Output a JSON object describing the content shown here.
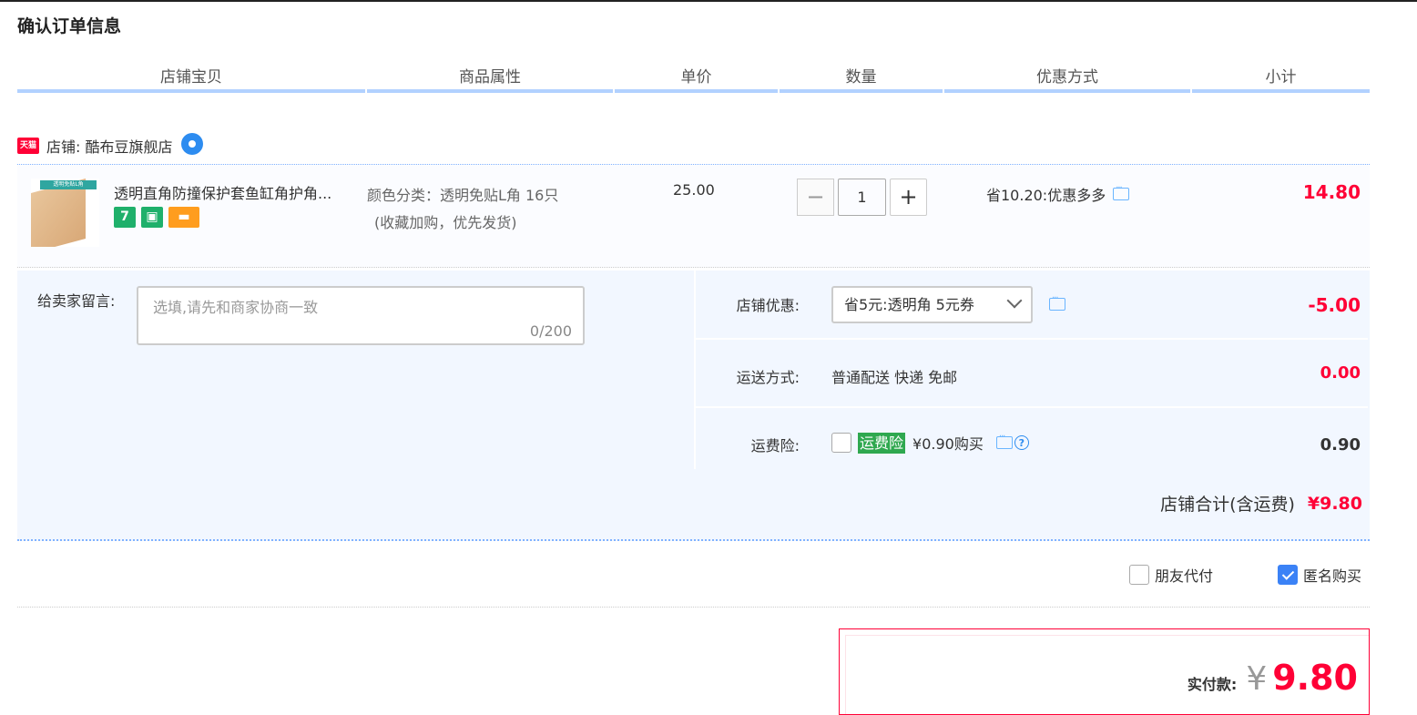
{
  "page_title": "确认订单信息",
  "columns": [
    "店铺宝贝",
    "商品属性",
    "单价",
    "数量",
    "优惠方式",
    "小计"
  ],
  "shop": {
    "platform_badge": "天猫",
    "label": "店铺: 酷布豆旗舰店"
  },
  "item": {
    "thumb_label": "透明免贴L角",
    "title": "透明直角防撞保护套鱼缸角护角...",
    "badges": [
      "7",
      "bag-icon",
      "card-icon"
    ],
    "attr_line1": "颜色分类：透明免贴L角 16只",
    "attr_line2": "(收藏加购，优先发货)",
    "unit_price": "25.00",
    "quantity": "1",
    "minus": "−",
    "plus": "+",
    "promo": "省10.20:优惠多多",
    "subtotal": "14.80"
  },
  "message": {
    "label": "给卖家留言:",
    "placeholder": "选填,请先和商家协商一致",
    "count": "0/200"
  },
  "shop_coupon": {
    "label": "店铺优惠:",
    "selected": "省5元:透明角 5元券",
    "value": "-5.00"
  },
  "shipping": {
    "label": "运送方式:",
    "text": "普通配送 快递 免邮",
    "value": "0.00"
  },
  "insurance": {
    "label": "运费险:",
    "tag": "运费险",
    "price_text": "¥0.90购买",
    "help": "?",
    "value": "0.90"
  },
  "shop_total": {
    "label": "店铺合计(含运费)",
    "value": "¥9.80"
  },
  "options": {
    "friend_pay": "朋友代付",
    "anonymous": "匿名购买",
    "anonymous_checked": true
  },
  "payment": {
    "label": "实付款:",
    "currency": "¥",
    "amount": "9.80"
  },
  "colors": {
    "accent_red": "#ff0036",
    "header_underline": "#b2d1ff",
    "panel_bg": "#f2f7ff"
  }
}
